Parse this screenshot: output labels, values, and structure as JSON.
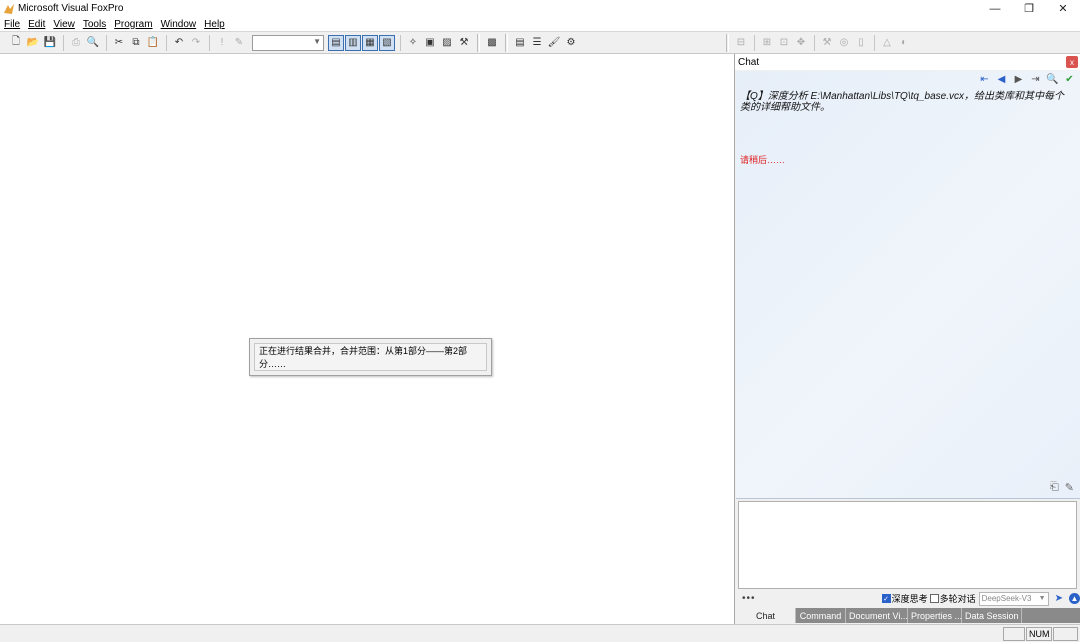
{
  "window": {
    "title": "Microsoft Visual FoxPro",
    "minimize": "—",
    "restore": "❐",
    "close": "✕"
  },
  "menu": [
    "File",
    "Edit",
    "View",
    "Tools",
    "Program",
    "Window",
    "Help"
  ],
  "toolbar": {
    "combo_value": ""
  },
  "progress_dialog": {
    "text": "正在进行结果合并，合并范围：从第1部分——第2部分……"
  },
  "chat": {
    "title": "Chat",
    "close": "x",
    "question": "【Q】深度分析 E:\\Manhattan\\Libs\\TQ\\tq_base.vcx，给出类库和其中每个类的详细帮助文件。",
    "waiting": "请稍后……",
    "input_value": "",
    "more": "•••",
    "deep_think_label": "深度思考",
    "deep_think_checked": true,
    "multi_turn_label": "多轮对话",
    "multi_turn_checked": false,
    "model": "DeepSeek-V3",
    "tabs": [
      "Chat",
      "Command",
      "Document Vi...",
      "Properties ...",
      "Data Session"
    ],
    "active_tab": "Chat"
  },
  "status": {
    "num": "NUM"
  },
  "colors": {
    "accent": "#2a62c9",
    "waiting_text": "#e02020",
    "chat_bg": "#e6eef8"
  }
}
